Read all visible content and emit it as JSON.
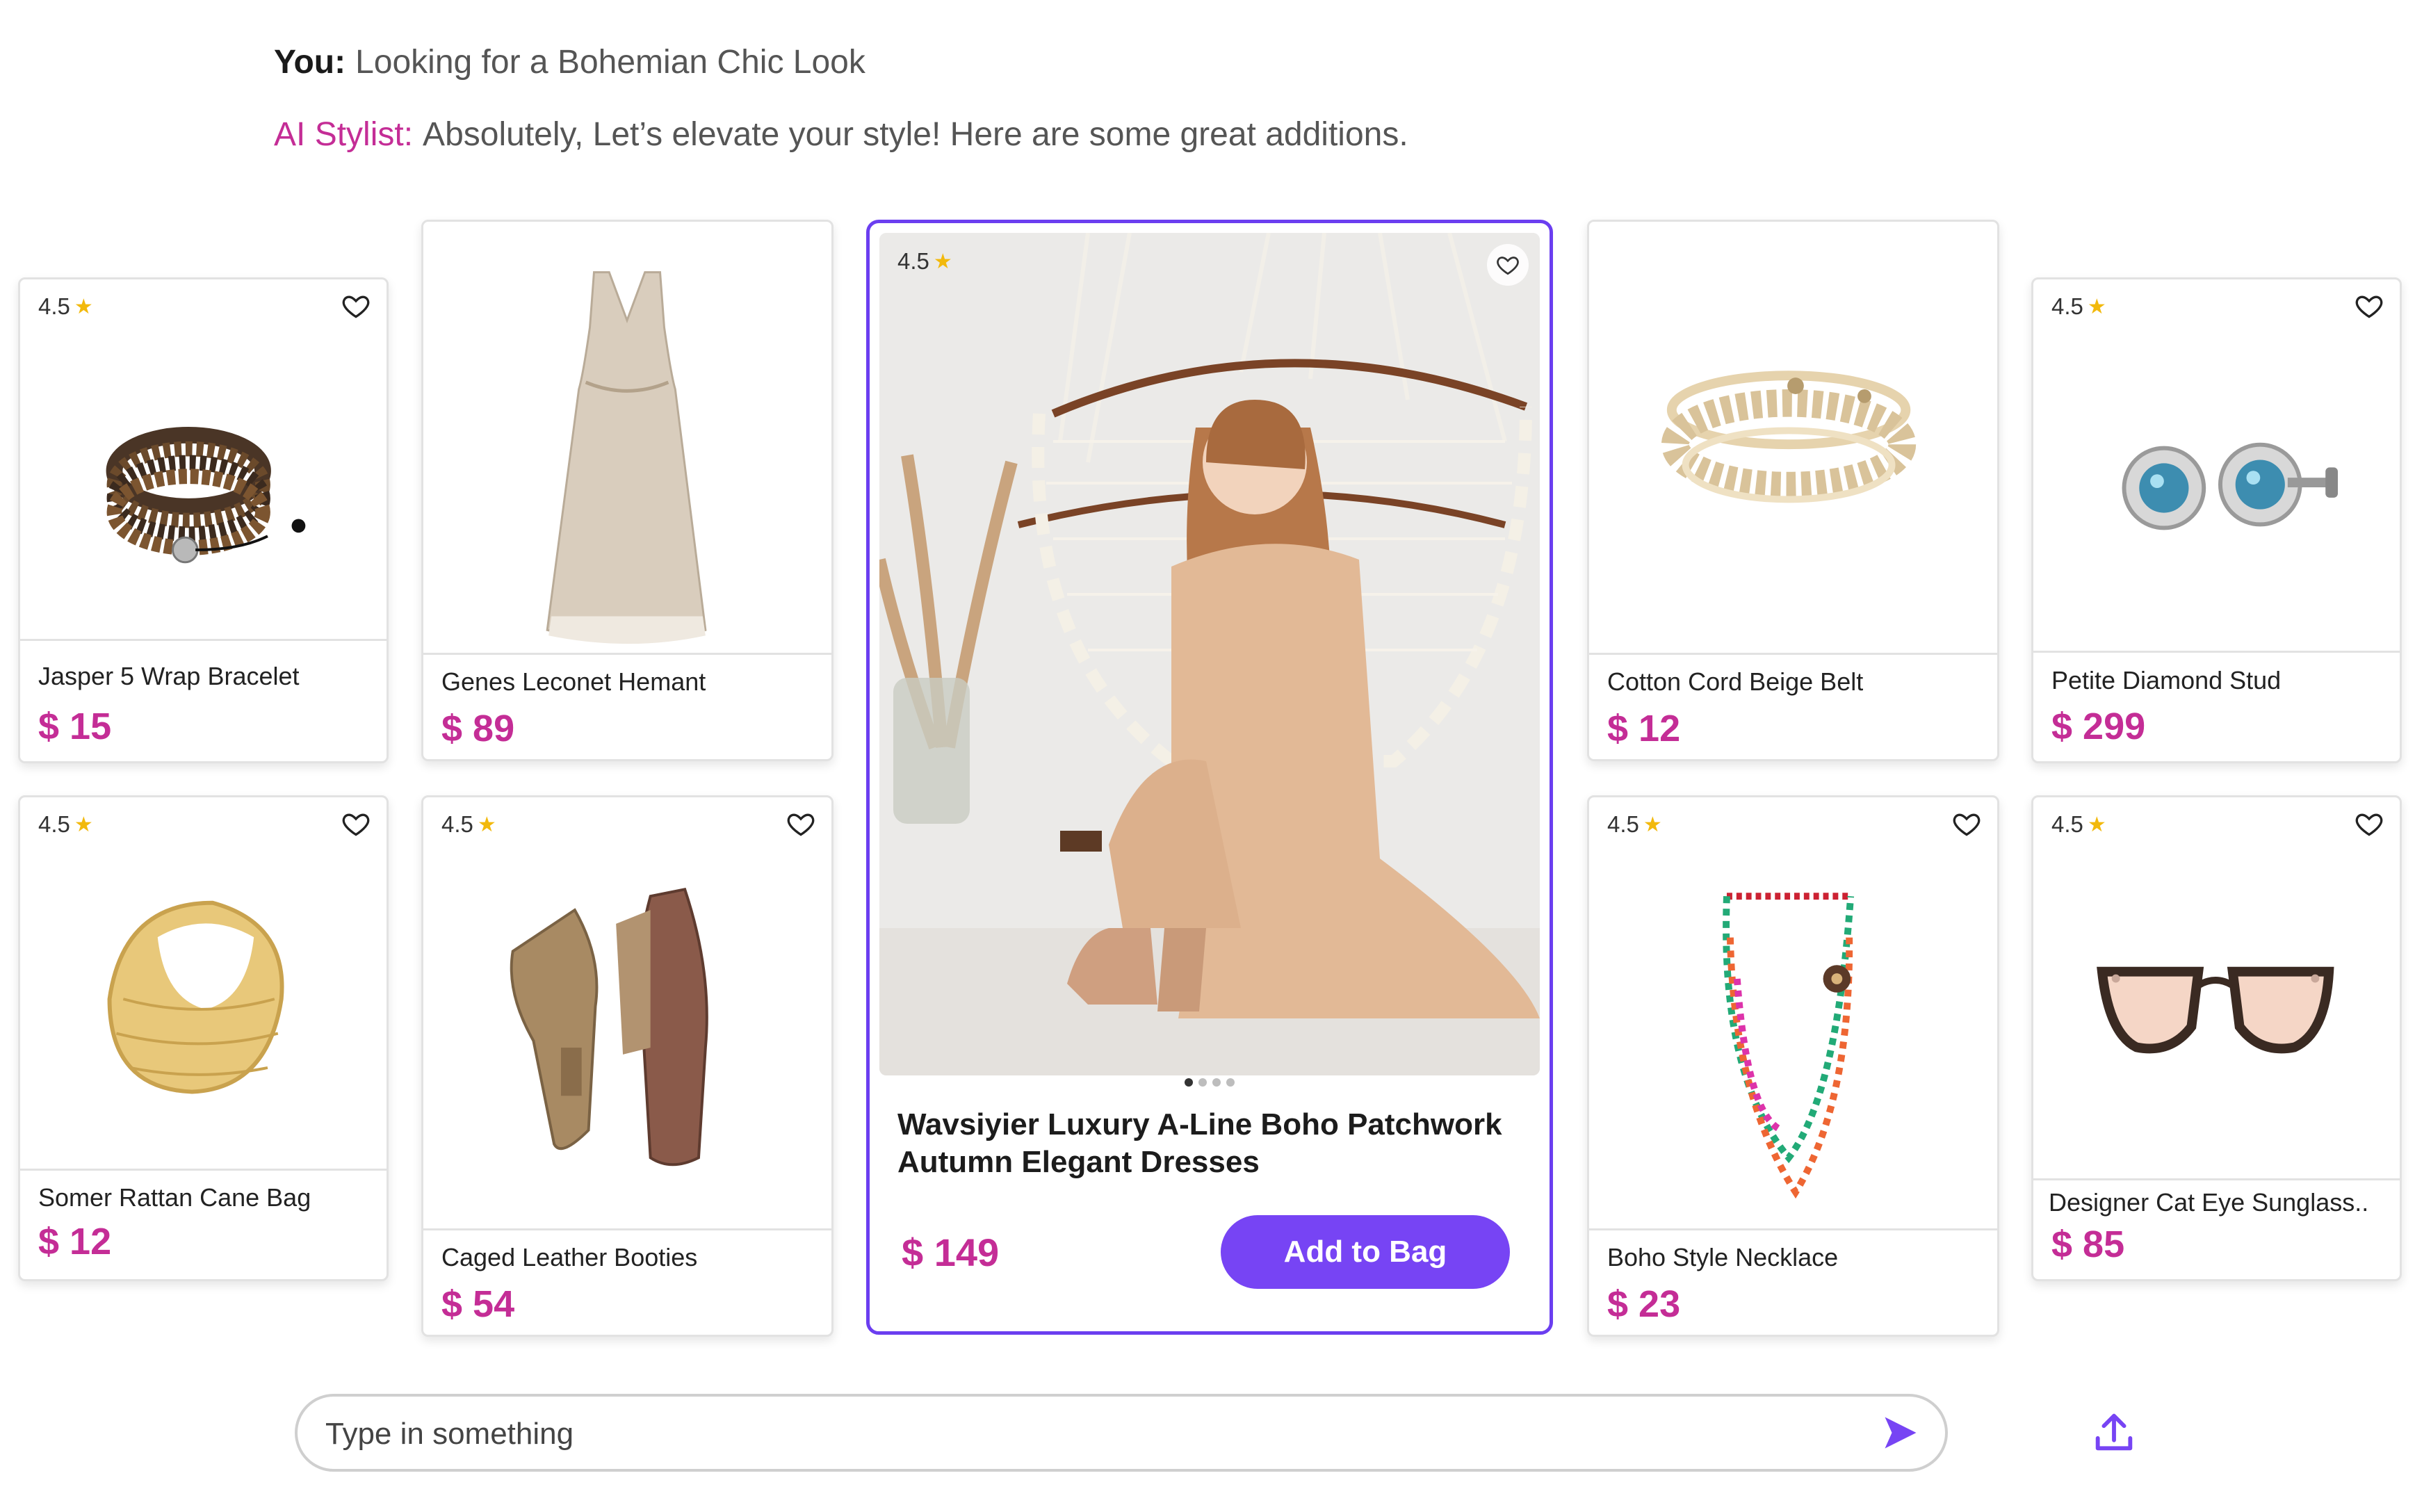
{
  "conversation": {
    "user_label": "You:",
    "user_text": "Looking for a Bohemian Chic Look",
    "ai_label": "AI Stylist:",
    "ai_text": "Absolutely, Let’s elevate your style! Here are some great additions."
  },
  "products": [
    {
      "id": "bracelet",
      "rating": "4.5",
      "name": "Jasper 5 Wrap Bracelet",
      "price": "$ 15",
      "image": "wrap-bracelet",
      "favorite_icon": "heart-outline-icon"
    },
    {
      "id": "dress",
      "rating": "",
      "name": "Genes Leconet Hemant",
      "price": "$ 89",
      "image": "beige-dress",
      "favorite_icon": ""
    },
    {
      "id": "belt",
      "rating": "",
      "name": "Cotton Cord Beige Belt",
      "price": "$ 12",
      "image": "cord-belt",
      "favorite_icon": ""
    },
    {
      "id": "earrings",
      "rating": "4.5",
      "name": "Petite Diamond Stud",
      "price": "$ 299",
      "image": "diamond-stud-earrings",
      "favorite_icon": "heart-outline-icon"
    },
    {
      "id": "bag",
      "rating": "4.5",
      "name": "Somer Rattan Cane Bag",
      "price": "$ 12",
      "image": "rattan-bag",
      "favorite_icon": "heart-outline-icon"
    },
    {
      "id": "booties",
      "rating": "4.5",
      "name": "Caged Leather Booties",
      "price": "$ 54",
      "image": "ankle-booties",
      "favorite_icon": "heart-outline-icon"
    },
    {
      "id": "necklace",
      "rating": "4.5",
      "name": "Boho Style Necklace",
      "price": "$ 23",
      "image": "beaded-necklace",
      "favorite_icon": "heart-outline-icon"
    },
    {
      "id": "sunglasses",
      "rating": "4.5",
      "name": "Designer Cat Eye Sunglass..",
      "price": "$ 85",
      "image": "cat-eye-sunglasses",
      "favorite_icon": "heart-outline-icon"
    }
  ],
  "featured": {
    "rating": "4.5",
    "title": "Wavsiyier Luxury A-Line Boho Patchwork Autumn Elegant Dresses",
    "price": "$ 149",
    "add_button": "Add to Bag",
    "image": "model-in-boho-dress",
    "carousel_total": 4,
    "carousel_active": 1
  },
  "chat_input": {
    "placeholder": "Type in something",
    "value": ""
  },
  "icons": {
    "send": "send-icon",
    "upload": "upload-icon",
    "favorite": "heart-outline-icon",
    "rating": "star-icon"
  },
  "colors": {
    "accent": "#7744f4",
    "price": "#c42d96",
    "star": "#f2b90c"
  }
}
